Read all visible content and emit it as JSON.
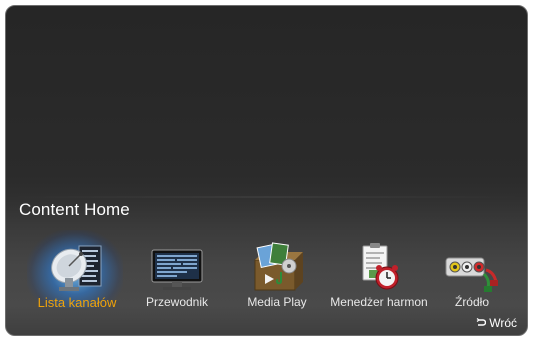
{
  "screen": {
    "title": "Content Home"
  },
  "menu": {
    "items": [
      {
        "label": "Lista kanałów",
        "icon": "satellite-dish-icon",
        "selected": true
      },
      {
        "label": "Przewodnik",
        "icon": "tv-guide-icon",
        "selected": false
      },
      {
        "label": "Media Play",
        "icon": "media-play-icon",
        "selected": false
      },
      {
        "label": "Menedżer harmon",
        "icon": "schedule-clock-icon",
        "selected": false
      },
      {
        "label": "Źródło",
        "icon": "source-connectors-icon",
        "selected": false
      }
    ]
  },
  "footer": {
    "back_label": "Wróć",
    "back_icon": "return-arrow-icon"
  },
  "colors": {
    "selected_label": "#f0a30a",
    "label": "#e8e8e8",
    "glow": "#3aa0ff"
  }
}
